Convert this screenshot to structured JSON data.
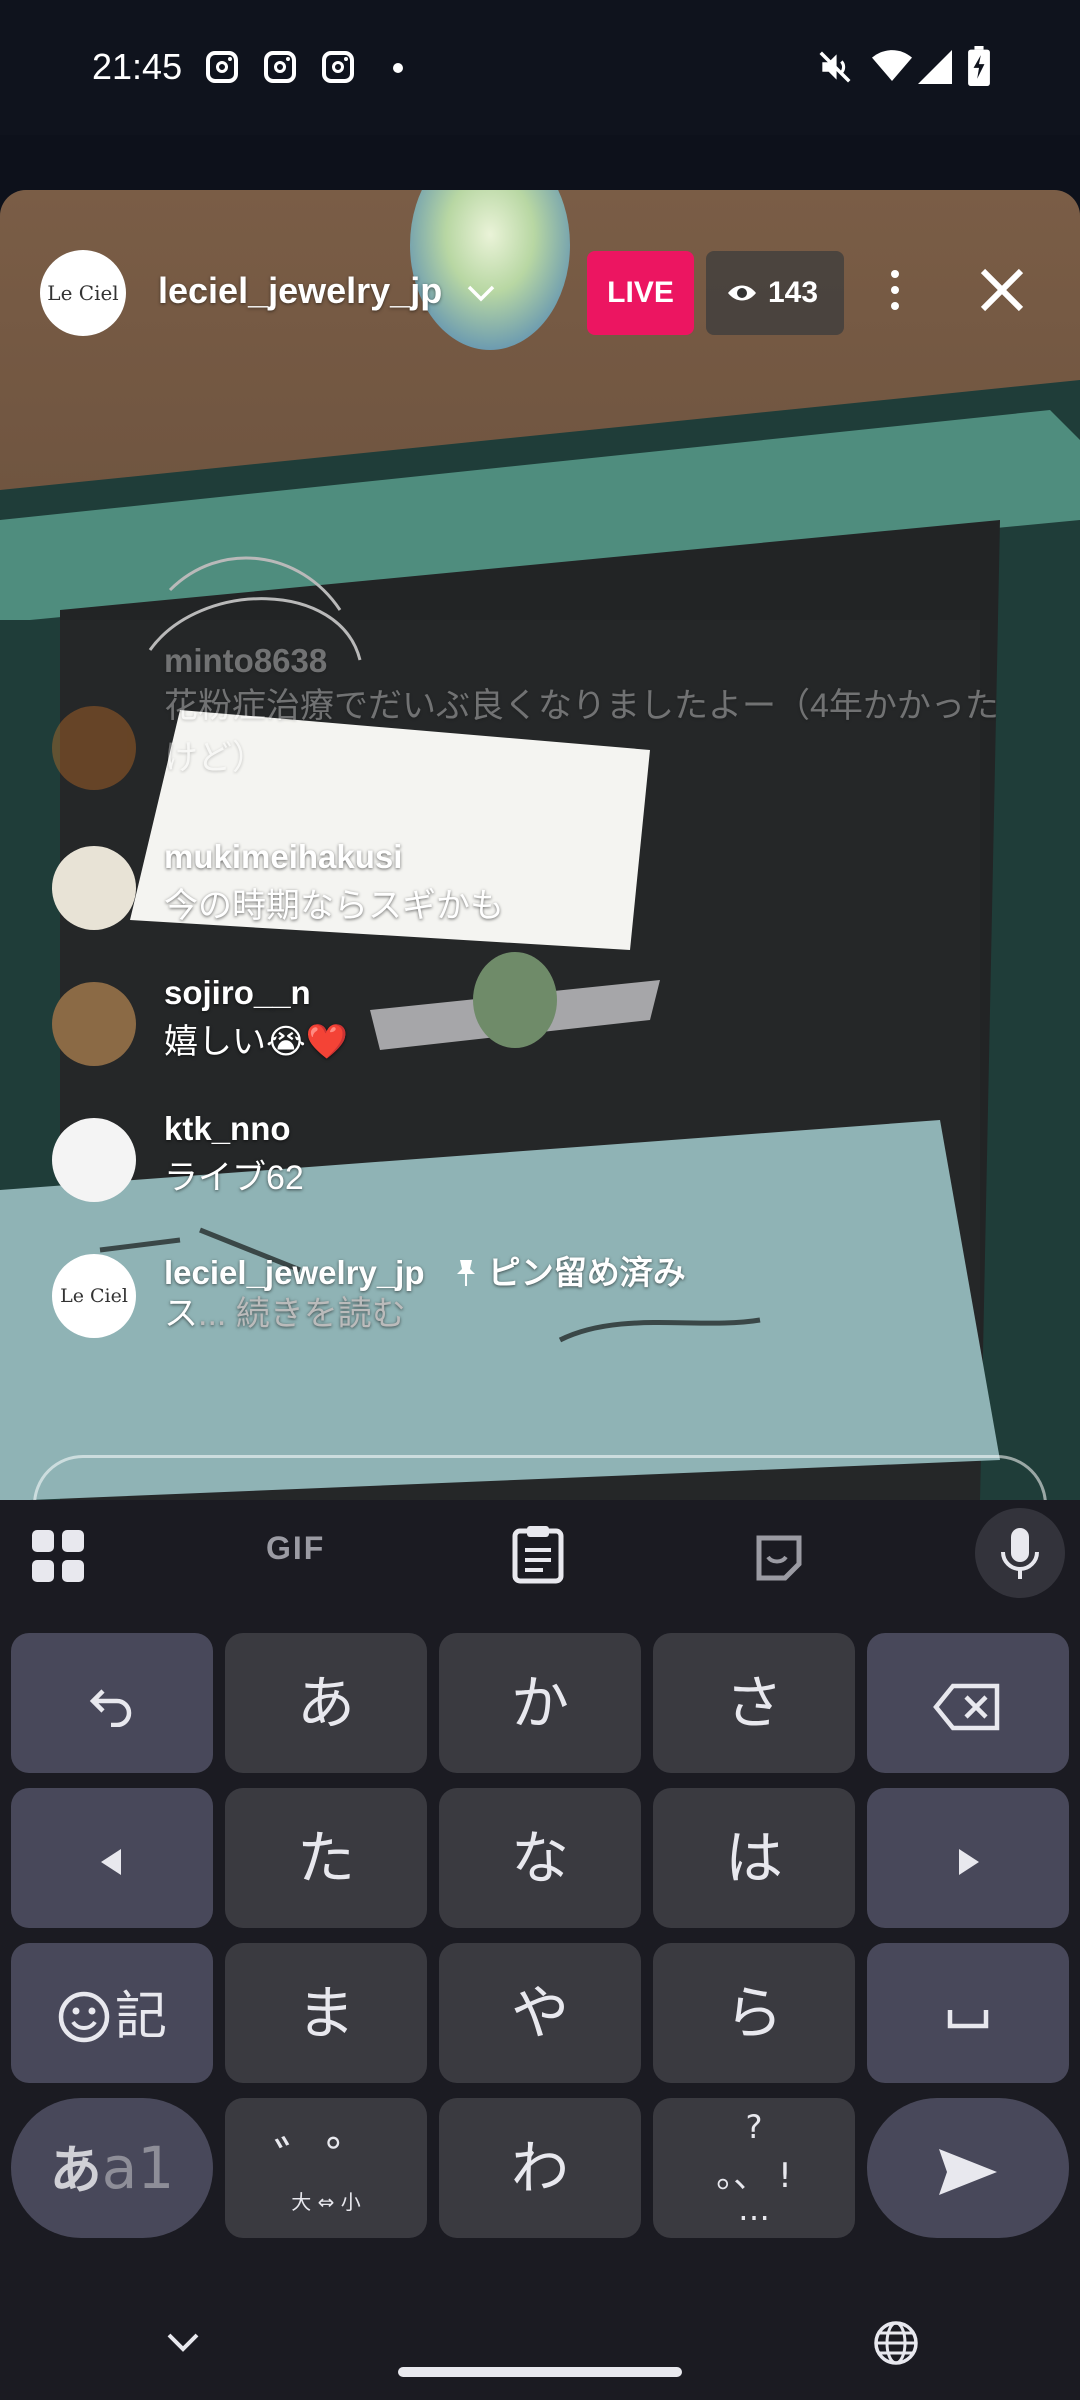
{
  "status_bar": {
    "time": "21:45",
    "notification_icons": [
      "instagram-icon",
      "instagram-icon",
      "instagram-icon",
      "dot-icon"
    ],
    "system_icons": [
      "mute-icon",
      "wifi-icon",
      "signal-icon",
      "battery-charging-icon"
    ]
  },
  "live": {
    "account_avatar_text": "Le Ciel",
    "username": "leciel_jewelry_jp",
    "live_label": "LIVE",
    "viewer_count": "143",
    "colors": {
      "live_badge": "#ec1561"
    }
  },
  "comments": [
    {
      "user": "minto8638",
      "text": "花粉症治療でだいぶ良くなりましたよー（4年かかったけど）",
      "faded": true
    },
    {
      "user": "mukimeihakusi",
      "text": "今の時期ならスギかも"
    },
    {
      "user": "sojiro__n",
      "text": "嬉しい😭❤️"
    },
    {
      "user": "ktk_nno",
      "text": "ライブ62"
    },
    {
      "user": "leciel_jewelry_jp",
      "pinned_label": "ピン留め済み",
      "text": "ス",
      "more_label": "... 続きを読む"
    }
  ],
  "keyboard": {
    "toolbar": [
      "apps-icon",
      "gif-icon",
      "clipboard-icon",
      "sticker-icon",
      "mic-icon"
    ],
    "gif_label": "GIF",
    "rows": [
      [
        "undo-icon",
        "あ",
        "か",
        "さ",
        "backspace-icon"
      ],
      [
        "left-arrow-icon",
        "た",
        "な",
        "は",
        "right-arrow-icon"
      ],
      [
        "記",
        "ま",
        "や",
        "ら",
        "space-icon"
      ],
      [
        "あa1",
        "゛゜",
        "わ",
        "、。?!",
        "send-icon"
      ]
    ],
    "emoji_key_label": "記",
    "mode_key_label_a": "あ",
    "mode_key_label_b": "a1",
    "dakuten_label": "゛゜",
    "size_label": "大 ⇔ 小",
    "punct_q": "?",
    "punct_row": "。、 !",
    "punct_dots": "…"
  },
  "nav_bar": {
    "icons": [
      "chevron-down-icon",
      "globe-icon"
    ]
  }
}
